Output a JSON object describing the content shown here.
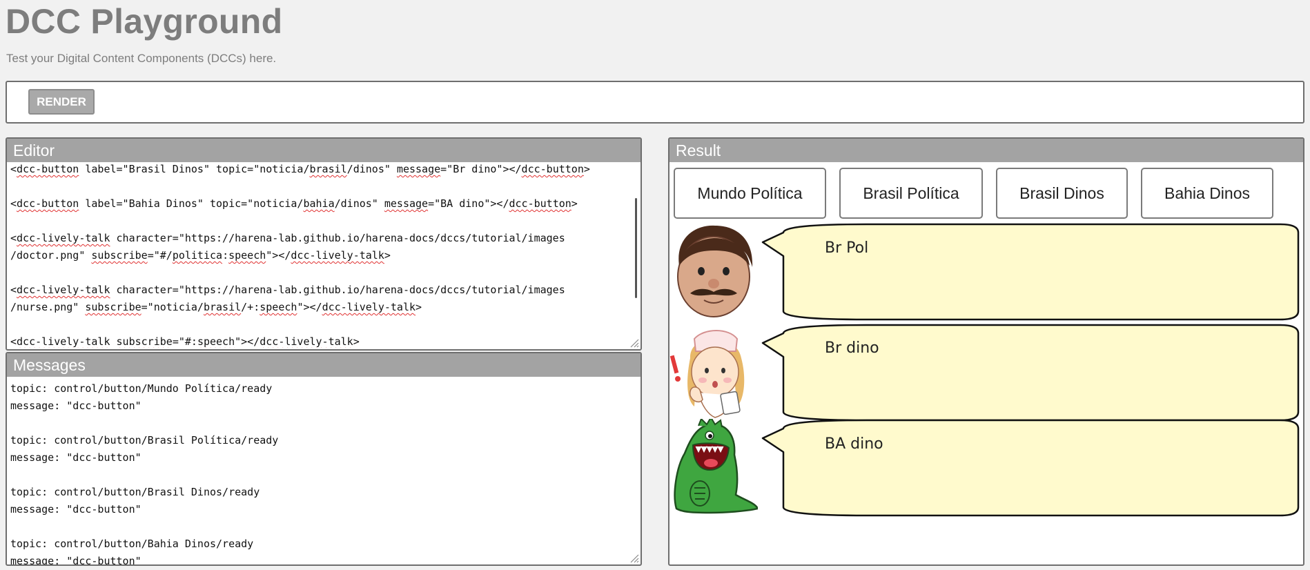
{
  "page": {
    "title": "DCC Playground",
    "subtitle": "Test your Digital Content Components (DCCs) here."
  },
  "toolbar": {
    "render_label": "RENDER"
  },
  "editor": {
    "header": "Editor",
    "lines": [
      "<dcc-button label=\"Brasil Dinos\" topic=\"noticia/brasil/dinos\" message=\"Br dino\"></dcc-button>",
      "",
      "<dcc-button label=\"Bahia Dinos\" topic=\"noticia/bahia/dinos\" message=\"BA dino\"></dcc-button>",
      "",
      "<dcc-lively-talk character=\"https://harena-lab.github.io/harena-docs/dccs/tutorial/images",
      "/doctor.png\" subscribe=\"#/politica:speech\"></dcc-lively-talk>",
      "",
      "<dcc-lively-talk character=\"https://harena-lab.github.io/harena-docs/dccs/tutorial/images",
      "/nurse.png\" subscribe=\"noticia/brasil/+:speech\"></dcc-lively-talk>",
      "",
      "<dcc-lively-talk subscribe=\"#:speech\"></dcc-lively-talk>"
    ]
  },
  "messages": {
    "header": "Messages",
    "lines": [
      "topic: control/button/Mundo Política/ready",
      "message: \"dcc-button\"",
      "",
      "topic: control/button/Brasil Política/ready",
      "message: \"dcc-button\"",
      "",
      "topic: control/button/Brasil Dinos/ready",
      "message: \"dcc-button\"",
      "",
      "topic: control/button/Bahia Dinos/ready",
      "message: \"dcc-button\""
    ]
  },
  "result": {
    "header": "Result",
    "buttons": [
      {
        "label": "Mundo Política"
      },
      {
        "label": "Brasil Política"
      },
      {
        "label": "Brasil Dinos"
      },
      {
        "label": "Bahia Dinos"
      }
    ],
    "talks": [
      {
        "character": "doctor-icon",
        "speech": "Br Pol"
      },
      {
        "character": "nurse-icon",
        "speech": "Br dino"
      },
      {
        "character": "dinosaur-icon",
        "speech": "BA dino"
      }
    ]
  },
  "colors": {
    "header_bg": "#a3a3a3",
    "bubble_fill": "#fffacd",
    "title_gray": "#7d7d7d",
    "render_bg": "#a9a9a9"
  }
}
